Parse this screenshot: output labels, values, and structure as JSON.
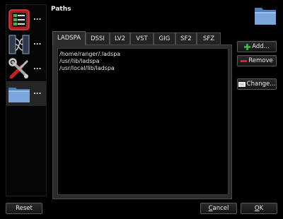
{
  "window": {
    "title": "Paths"
  },
  "sidebar": {
    "items": [
      {
        "icon": "plugin-settings-icon",
        "more": "..."
      },
      {
        "icon": "wiring-icon",
        "more": "..."
      },
      {
        "icon": "tools-icon",
        "more": "..."
      },
      {
        "icon": "folder-icon",
        "more": "...",
        "selected": true
      }
    ]
  },
  "tabs": [
    "LADSPA",
    "DSSI",
    "LV2",
    "VST",
    "GIG",
    "SF2",
    "SFZ"
  ],
  "active_tab": "LADSPA",
  "paths": [
    "/home/ranger/.ladspa",
    "/usr/lib/ladspa",
    "/usr/local/lib/ladspa"
  ],
  "buttons": {
    "add": "Add...",
    "remove": "Remove",
    "change": "Change...",
    "reset": "Reset",
    "cancel_prefix": "",
    "cancel_key": "C",
    "cancel_rest": "ancel",
    "ok_key": "O",
    "ok_rest": "K"
  },
  "colors": {
    "background": "#000000",
    "panel": "#2b2b2b",
    "add_icon": "#3fbf3f",
    "remove_icon": "#e03030",
    "folder": "#6f9fd8"
  }
}
